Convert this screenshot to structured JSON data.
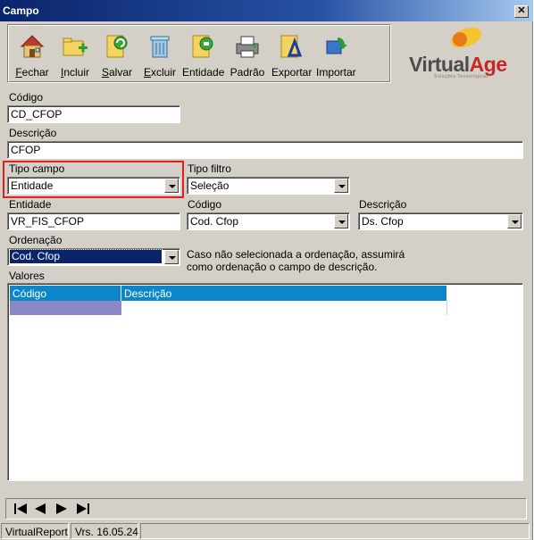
{
  "window": {
    "title": "Campo",
    "close_label": "✕"
  },
  "toolbar": {
    "items": [
      {
        "label": "Fechar",
        "accel": "F",
        "rest": "echar",
        "icon": "house-icon"
      },
      {
        "label": "Incluir",
        "accel": "I",
        "rest": "ncluir",
        "icon": "add-folder-icon"
      },
      {
        "label": "Salvar",
        "accel": "S",
        "rest": "alvar",
        "icon": "save-folder-icon"
      },
      {
        "label": "Excluir",
        "accel": "E",
        "rest": "xcluir",
        "icon": "trash-icon"
      },
      {
        "label": "Entidade",
        "accel": "",
        "rest": "Entidade",
        "icon": "entity-folder-icon"
      },
      {
        "label": "Padrão",
        "accel": "",
        "rest": "Padrão",
        "icon": "printer-icon"
      },
      {
        "label": "Exportar",
        "accel": "",
        "rest": "Exportar",
        "icon": "export-folder-icon"
      },
      {
        "label": "Importar",
        "accel": "",
        "rest": "Importar",
        "icon": "import-icon"
      }
    ]
  },
  "logo": {
    "brand_virtual": "Virtual",
    "brand_age": "Age",
    "tagline": "Soluções Tecnológicas"
  },
  "form": {
    "codigo": {
      "label": "Código",
      "value": "CD_CFOP"
    },
    "descricao": {
      "label": "Descrição",
      "value": "CFOP"
    },
    "tipo_campo": {
      "label": "Tipo campo",
      "value": "Entidade"
    },
    "tipo_filtro": {
      "label": "Tipo filtro",
      "value": "Seleção"
    },
    "entidade": {
      "label": "Entidade",
      "value": "VR_FIS_CFOP"
    },
    "ent_codigo": {
      "label": "Código",
      "value": "Cod. Cfop"
    },
    "ent_descricao": {
      "label": "Descrição",
      "value": "Ds. Cfop"
    },
    "ordenacao": {
      "label": "Ordenação",
      "value": "Cod. Cfop"
    },
    "ordenacao_hint_1": "Caso não selecionada a ordenação, assumirá",
    "ordenacao_hint_2": "como ordenação o campo de descrição.",
    "valores_label": "Valores"
  },
  "grid": {
    "columns": [
      "Código",
      "Descrição"
    ]
  },
  "status": {
    "app": "VirtualReport",
    "version": "Vrs. 16.05.24"
  },
  "colors": {
    "grid_header": "#0c86c8",
    "grid_row_selected": "#8c88c8",
    "highlight": "#e02020"
  }
}
